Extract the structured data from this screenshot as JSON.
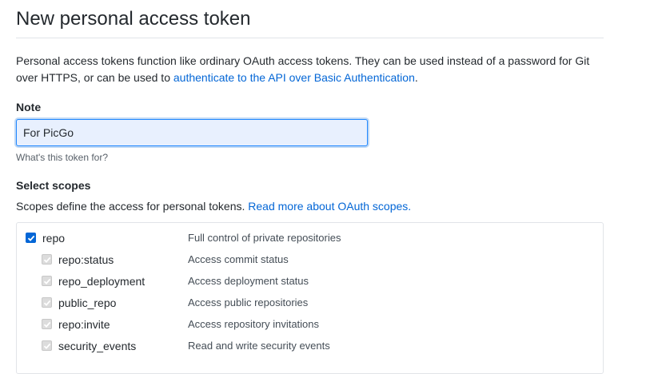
{
  "header": {
    "title": "New personal access token"
  },
  "intro": {
    "text_before": "Personal access tokens function like ordinary OAuth access tokens. They can be used instead of a password for Git over HTTPS, or can be used to ",
    "link": "authenticate to the API over Basic Authentication",
    "text_after": "."
  },
  "note": {
    "label": "Note",
    "value": "For PicGo",
    "help": "What's this token for?"
  },
  "scopes": {
    "heading": "Select scopes",
    "desc_before": "Scopes define the access for personal tokens. ",
    "desc_link": "Read more about OAuth scopes.",
    "parent": {
      "name": "repo",
      "desc": "Full control of private repositories",
      "checked": true
    },
    "children": [
      {
        "name": "repo:status",
        "desc": "Access commit status",
        "checked": true
      },
      {
        "name": "repo_deployment",
        "desc": "Access deployment status",
        "checked": true
      },
      {
        "name": "public_repo",
        "desc": "Access public repositories",
        "checked": true
      },
      {
        "name": "repo:invite",
        "desc": "Access repository invitations",
        "checked": true
      },
      {
        "name": "security_events",
        "desc": "Read and write security events",
        "checked": true
      }
    ]
  },
  "colors": {
    "link": "#0366d6",
    "checkbox": "#0366d6",
    "focus_border": "#2188ff"
  }
}
